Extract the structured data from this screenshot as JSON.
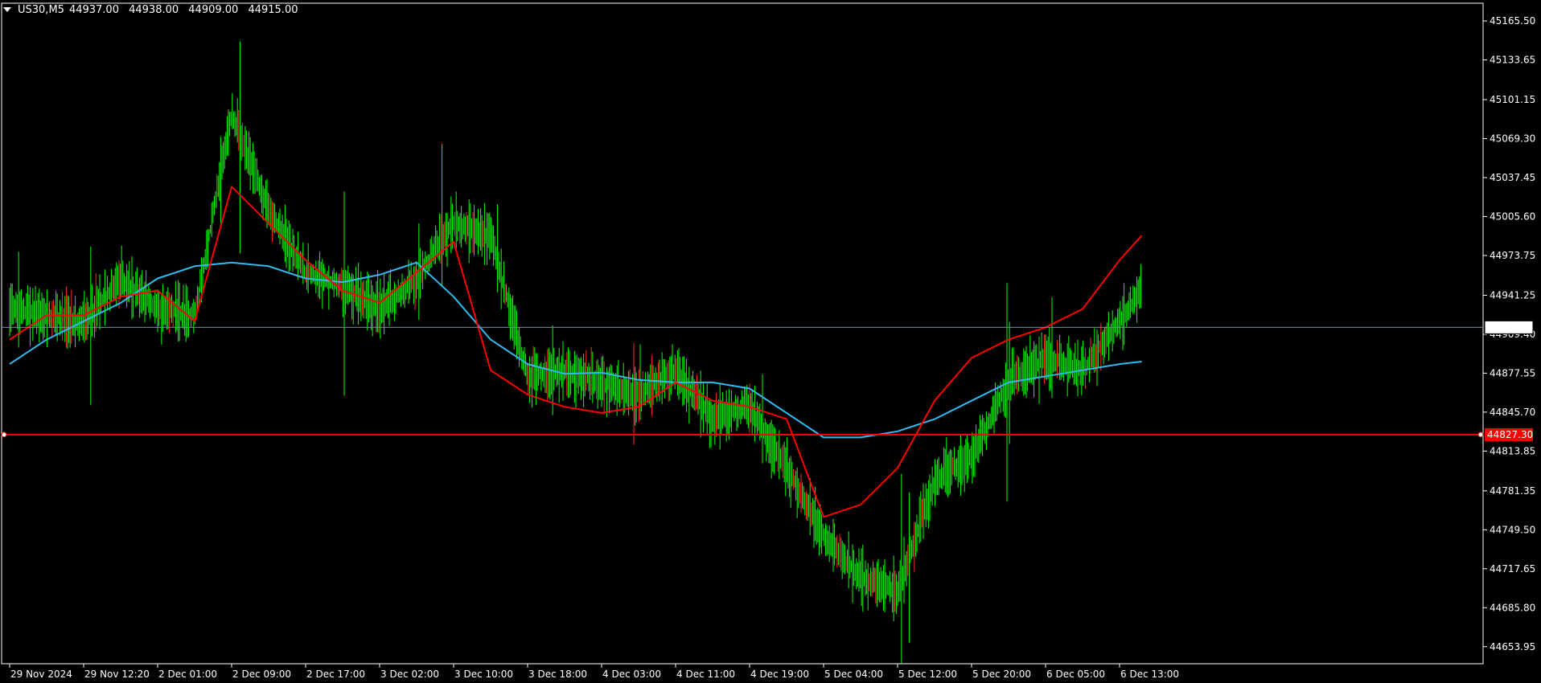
{
  "header": {
    "symbol": "US30,M5",
    "open": "44937.00",
    "high": "44938.00",
    "low": "44909.00",
    "close": "44915.00"
  },
  "colors": {
    "background": "#000000",
    "frame": "#ffffff",
    "candle": "#00ff00",
    "candle_alt": "#ff2a2a",
    "fast_ma": "#ff0000",
    "slow_ma": "#2fbcf0",
    "hline": "#ff0000",
    "current_price_line": "#6b8fa5"
  },
  "chart_data": {
    "type": "line",
    "title": "",
    "symbol": "US30",
    "timeframe": "M5",
    "y_range": [
      44640,
      45180
    ],
    "y_ticks": [
      "45165.50",
      "45133.65",
      "45101.15",
      "45069.30",
      "45037.45",
      "45005.60",
      "44973.75",
      "44941.25",
      "44909.40",
      "44877.55",
      "44845.70",
      "44813.85",
      "44781.35",
      "44749.50",
      "44717.65",
      "44685.80",
      "44653.95"
    ],
    "x_ticks": [
      "29 Nov 2024",
      "29 Nov 12:20",
      "2 Dec 01:00",
      "2 Dec 09:00",
      "2 Dec 17:00",
      "3 Dec 02:00",
      "3 Dec 10:00",
      "3 Dec 18:00",
      "4 Dec 03:00",
      "4 Dec 11:00",
      "4 Dec 19:00",
      "5 Dec 04:00",
      "5 Dec 12:00",
      "5 Dec 20:00",
      "6 Dec 05:00",
      "6 Dec 13:00"
    ],
    "grid": false,
    "current_price": "44915.00",
    "horizontal_line_price": "44827.30",
    "x": [
      0,
      0.5,
      1,
      1.5,
      2,
      2.5,
      3,
      3.5,
      4,
      4.5,
      5,
      5.5,
      6,
      6.5,
      7,
      7.5,
      8,
      8.5,
      9,
      9.5,
      10,
      10.5,
      11,
      11.5,
      12,
      12.5,
      13,
      13.5,
      14,
      14.5,
      15,
      15.3
    ],
    "series": [
      {
        "kind": "price",
        "values": [
          44930,
          44925,
          44918,
          44955,
          44930,
          44925,
          45090,
          45010,
          44960,
          44950,
          44930,
          44955,
          45000,
          44990,
          44875,
          44880,
          44870,
          44860,
          44880,
          44840,
          44850,
          44800,
          44745,
          44710,
          44700,
          44790,
          44810,
          44870,
          44890,
          44880,
          44920,
          44945
        ]
      },
      {
        "kind": "ma-fast",
        "values": [
          44905,
          44925,
          44925,
          44940,
          44945,
          44920,
          45030,
          45000,
          44970,
          44945,
          44935,
          44960,
          44985,
          44880,
          44860,
          44850,
          44845,
          44850,
          44870,
          44855,
          44850,
          44840,
          44760,
          44770,
          44800,
          44855,
          44890,
          44905,
          44915,
          44930,
          44970,
          44990
        ]
      },
      {
        "kind": "ma-slow",
        "values": [
          44885,
          44905,
          44920,
          44935,
          44955,
          44965,
          44968,
          44965,
          44955,
          44952,
          44958,
          44968,
          44940,
          44905,
          44885,
          44877,
          44878,
          44872,
          44870,
          44870,
          44865,
          44845,
          44825,
          44825,
          44830,
          44840,
          44855,
          44870,
          44875,
          44880,
          44885,
          44887
        ]
      }
    ]
  }
}
